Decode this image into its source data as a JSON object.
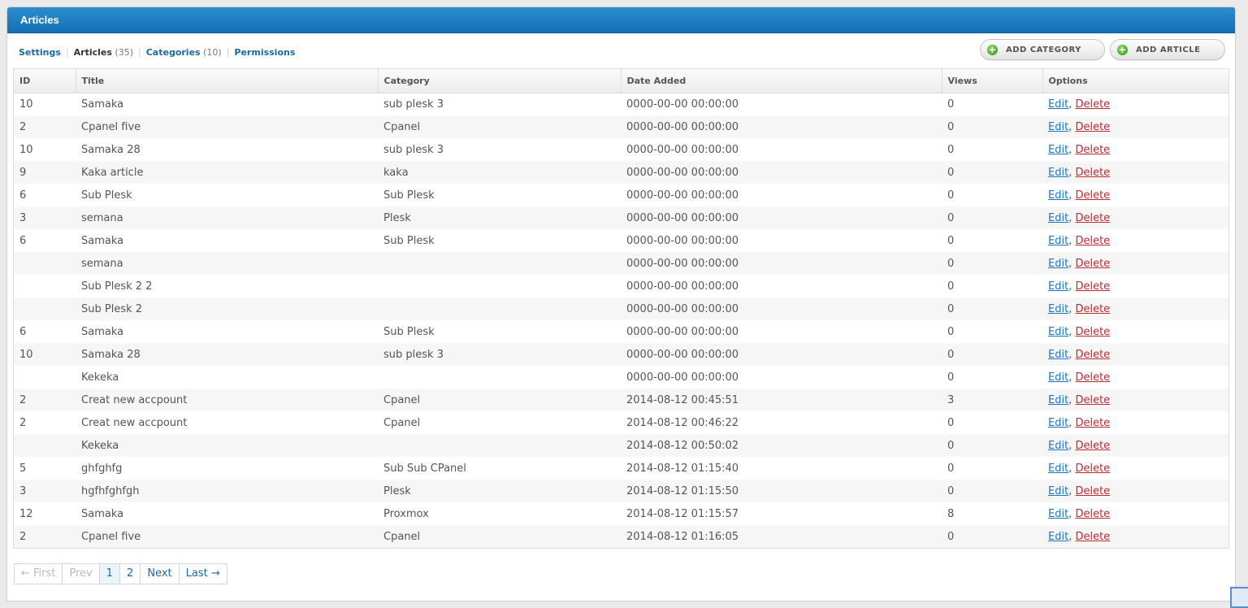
{
  "header": {
    "title": "Articles"
  },
  "subnav": {
    "settings": "Settings",
    "articles": "Articles",
    "articles_count": "(35)",
    "categories": "Categories",
    "categories_count": "(10)",
    "permissions": "Permissions"
  },
  "buttons": {
    "add_category": "ADD CATEGORY",
    "add_article": "ADD ARTICLE"
  },
  "table": {
    "headers": [
      "ID",
      "Title",
      "Category",
      "Date Added",
      "Views",
      "Options"
    ],
    "edit_label": "Edit",
    "delete_label": "Delete",
    "rows": [
      [
        "10",
        "Samaka",
        "sub plesk 3",
        "0000-00-00 00:00:00",
        "0"
      ],
      [
        "2",
        "Cpanel five",
        "Cpanel",
        "0000-00-00 00:00:00",
        "0"
      ],
      [
        "10",
        "Samaka 28",
        "sub plesk 3",
        "0000-00-00 00:00:00",
        "0"
      ],
      [
        "9",
        "Kaka article",
        "kaka",
        "0000-00-00 00:00:00",
        "0"
      ],
      [
        "6",
        "Sub Plesk",
        "Sub Plesk",
        "0000-00-00 00:00:00",
        "0"
      ],
      [
        "3",
        "semana",
        "Plesk",
        "0000-00-00 00:00:00",
        "0"
      ],
      [
        "6",
        "Samaka",
        "Sub Plesk",
        "0000-00-00 00:00:00",
        "0"
      ],
      [
        "",
        "semana",
        "",
        "0000-00-00 00:00:00",
        "0"
      ],
      [
        "",
        "Sub Plesk 2 2",
        "",
        "0000-00-00 00:00:00",
        "0"
      ],
      [
        "",
        "Sub Plesk 2",
        "",
        "0000-00-00 00:00:00",
        "0"
      ],
      [
        "6",
        "Samaka",
        "Sub Plesk",
        "0000-00-00 00:00:00",
        "0"
      ],
      [
        "10",
        "Samaka 28",
        "sub plesk 3",
        "0000-00-00 00:00:00",
        "0"
      ],
      [
        "",
        "Kekeka",
        "",
        "0000-00-00 00:00:00",
        "0"
      ],
      [
        "2",
        "Creat new accpount",
        "Cpanel",
        "2014-08-12 00:45:51",
        "3"
      ],
      [
        "2",
        "Creat new accpount",
        "Cpanel",
        "2014-08-12 00:46:22",
        "0"
      ],
      [
        "",
        "Kekeka",
        "",
        "2014-08-12 00:50:02",
        "0"
      ],
      [
        "5",
        "ghfghfg",
        "Sub Sub CPanel",
        "2014-08-12 01:15:40",
        "0"
      ],
      [
        "3",
        "hgfhfghfgh",
        "Plesk",
        "2014-08-12 01:15:50",
        "0"
      ],
      [
        "12",
        "Samaka",
        "Proxmox",
        "2014-08-12 01:15:57",
        "8"
      ],
      [
        "2",
        "Cpanel five",
        "Cpanel",
        "2014-08-12 01:16:05",
        "0"
      ]
    ]
  },
  "pagination": {
    "first": "← First",
    "prev": "Prev",
    "pages": [
      "1",
      "2"
    ],
    "next": "Next",
    "last": "Last →",
    "current_page": "1"
  }
}
